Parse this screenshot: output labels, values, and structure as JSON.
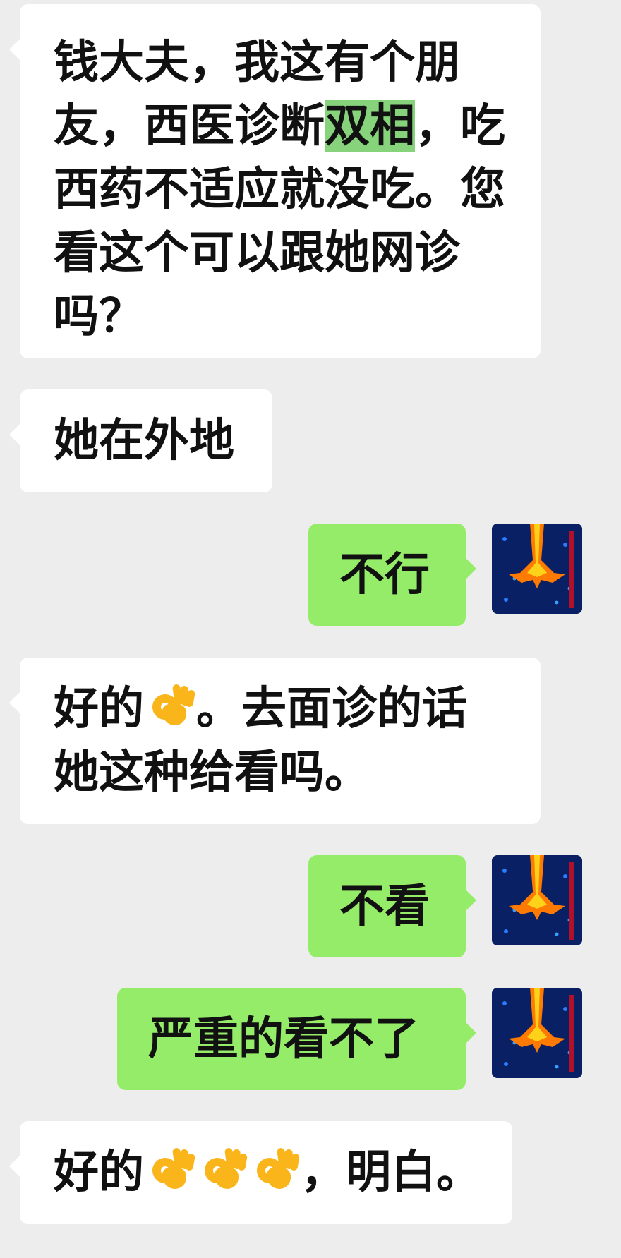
{
  "messages": [
    {
      "sender": "other",
      "text_before": "钱大夫，我这有个朋友，西医诊断",
      "highlight": "双相",
      "text_after": "，吃西药不适应就没吃。您看这个可以跟她网诊吗？"
    },
    {
      "sender": "other",
      "text": "她在外地"
    },
    {
      "sender": "self",
      "text": "不行"
    },
    {
      "sender": "other",
      "text_before": "好的",
      "text_after": "。去面诊的话她这种给看吗。",
      "emoji": "ok-hand"
    },
    {
      "sender": "self",
      "text": "不看"
    },
    {
      "sender": "self",
      "text": "严重的看不了"
    },
    {
      "sender": "other",
      "text_before": "好的",
      "text_after": "，明白。",
      "emoji": "ok-hand"
    }
  ],
  "colors": {
    "background": "#ededed",
    "incoming_bubble": "#ffffff",
    "outgoing_bubble": "#95ec69",
    "highlight": "#87d37c",
    "emoji": "#f9b51a"
  },
  "icons": {
    "avatar": "avatar-image",
    "emoji": "ok-hand-emoji"
  }
}
